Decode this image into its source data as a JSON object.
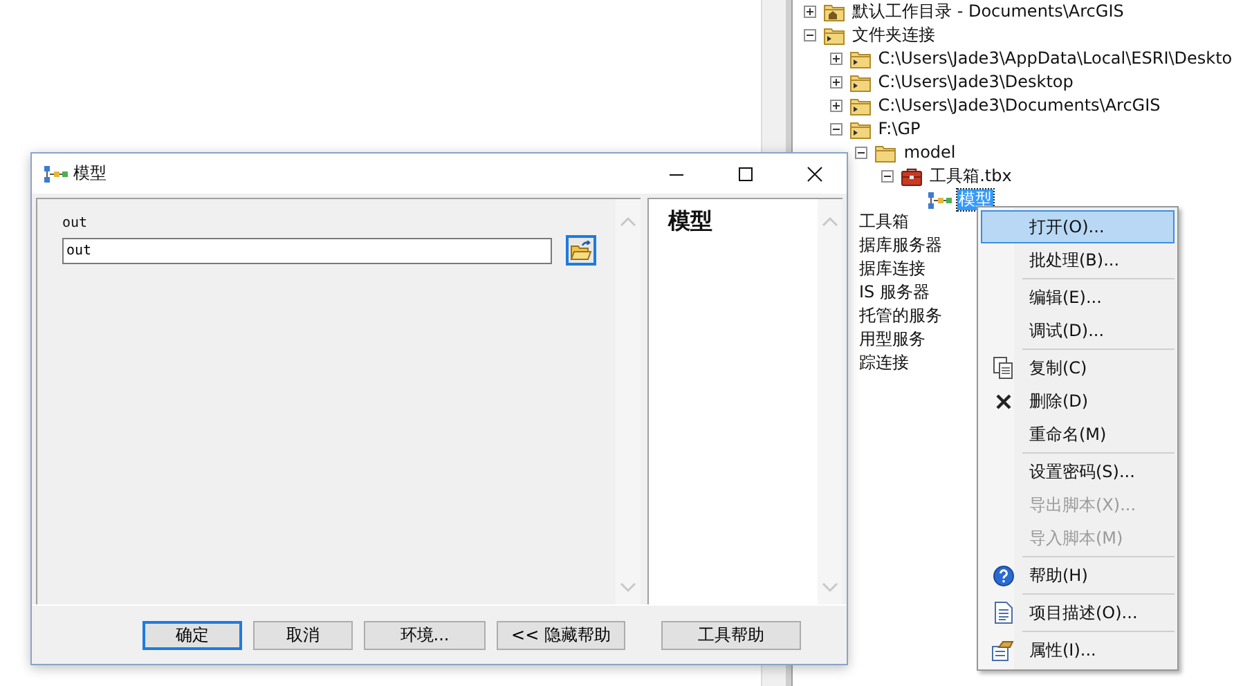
{
  "tree": [
    {
      "label": "默认工作目录 - Documents\\ArcGIS",
      "kind": "home-folder",
      "expanded": false,
      "selected": false
    },
    {
      "label": "文件夹连接",
      "kind": "folder-link",
      "expanded": true,
      "selected": false,
      "children": [
        {
          "label": "C:\\Users\\Jade3\\AppData\\Local\\ESRI\\Deskto",
          "kind": "folder-link",
          "expanded": false,
          "selected": false
        },
        {
          "label": "C:\\Users\\Jade3\\Desktop",
          "kind": "folder-link",
          "expanded": false,
          "selected": false
        },
        {
          "label": "C:\\Users\\Jade3\\Documents\\ArcGIS",
          "kind": "folder-link",
          "expanded": false,
          "selected": false
        },
        {
          "label": "F:\\GP",
          "kind": "folder-link",
          "expanded": true,
          "selected": false,
          "children": [
            {
              "label": "model",
              "kind": "folder",
              "expanded": true,
              "selected": false,
              "children": [
                {
                  "label": "工具箱.tbx",
                  "kind": "toolbox",
                  "expanded": true,
                  "selected": false,
                  "children": [
                    {
                      "label": "模型",
                      "kind": "model",
                      "selected": true
                    }
                  ]
                }
              ]
            }
          ]
        }
      ]
    }
  ],
  "tree_partial": [
    "工具箱",
    "据库服务器",
    "据库连接",
    "IS 服务器",
    "托管的服务",
    "用型服务",
    "踪连接"
  ],
  "dialog": {
    "title": "模型",
    "field_label": "out",
    "field_value": "out",
    "help_title": "模型",
    "buttons": [
      {
        "label": "确定",
        "focused": true
      },
      {
        "label": "取消",
        "focused": false
      },
      {
        "label": "环境...",
        "focused": false
      },
      {
        "label": "<< 隐藏帮助",
        "focused": false
      },
      {
        "label": "工具帮助",
        "focused": false
      }
    ]
  },
  "context_menu": [
    {
      "kind": "plain",
      "label": "打开(O)...",
      "selected": true,
      "disabled": false
    },
    {
      "kind": "plain",
      "label": "批处理(B)...",
      "selected": false,
      "disabled": false
    },
    {
      "kind": "separator"
    },
    {
      "kind": "plain",
      "label": "编辑(E)...",
      "selected": false,
      "disabled": false
    },
    {
      "kind": "plain",
      "label": "调试(D)...",
      "selected": false,
      "disabled": false
    },
    {
      "kind": "separator"
    },
    {
      "kind": "copy",
      "label": "复制(C)",
      "selected": false,
      "disabled": false
    },
    {
      "kind": "delete",
      "label": "删除(D)",
      "selected": false,
      "disabled": false
    },
    {
      "kind": "plain",
      "label": "重命名(M)",
      "selected": false,
      "disabled": false
    },
    {
      "kind": "separator"
    },
    {
      "kind": "plain",
      "label": "设置密码(S)...",
      "selected": false,
      "disabled": false
    },
    {
      "kind": "plain",
      "label": "导出脚本(X)...",
      "selected": false,
      "disabled": true
    },
    {
      "kind": "plain",
      "label": "导入脚本(M)",
      "selected": false,
      "disabled": true
    },
    {
      "kind": "separator"
    },
    {
      "kind": "help",
      "label": "帮助(H)",
      "selected": false,
      "disabled": false
    },
    {
      "kind": "separator"
    },
    {
      "kind": "document",
      "label": "项目描述(O)...",
      "selected": false,
      "disabled": false
    },
    {
      "kind": "separator"
    },
    {
      "kind": "properties",
      "label": "属性(I)...",
      "selected": false,
      "disabled": false
    }
  ]
}
